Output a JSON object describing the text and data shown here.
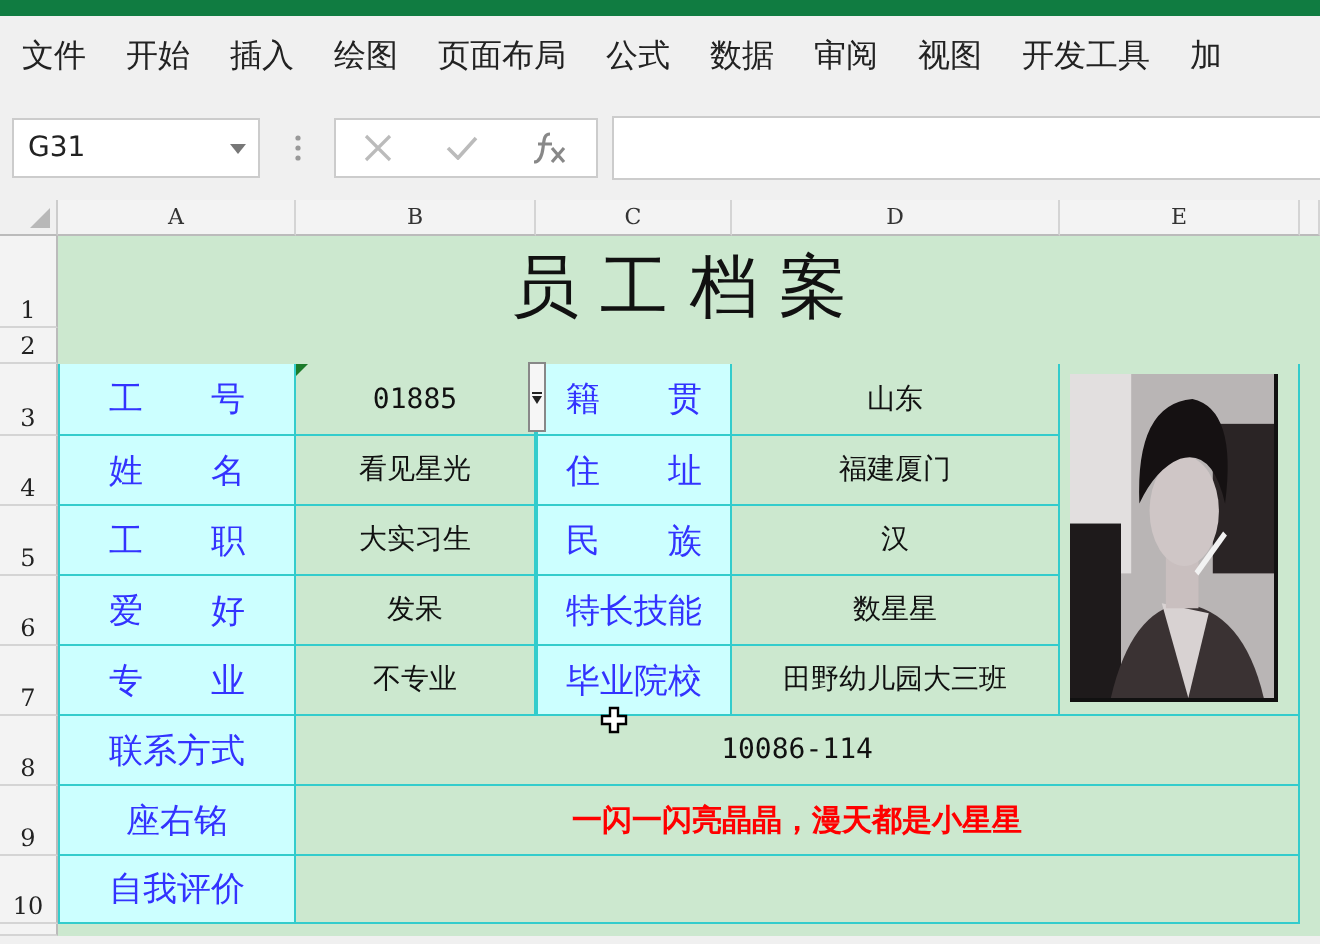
{
  "menu": [
    "文件",
    "开始",
    "插入",
    "绘图",
    "页面布局",
    "公式",
    "数据",
    "审阅",
    "视图",
    "开发工具",
    "加"
  ],
  "name_box": {
    "value": "G31"
  },
  "columns": [
    "A",
    "B",
    "C",
    "D",
    "E"
  ],
  "rows": [
    "1",
    "2",
    "3",
    "4",
    "5",
    "6",
    "7",
    "8",
    "9",
    "10"
  ],
  "sheet": {
    "title": "员 工 档 案",
    "profile": [
      {
        "label": "工　　号",
        "value": "01885",
        "label2": "籍　　贯",
        "value2": "山东",
        "dropdown": true
      },
      {
        "label": "姓　　名",
        "value": "看见星光",
        "label2": "住　　址",
        "value2": "福建厦门",
        "dropdown": false
      },
      {
        "label": "工　　职",
        "value": "大实习生",
        "label2": "民　　族",
        "value2": "汉",
        "dropdown": false
      },
      {
        "label": "爱　　好",
        "value": "发呆",
        "label2": "特长技能",
        "value2": "数星星",
        "dropdown": false
      },
      {
        "label": "专　　业",
        "value": "不专业",
        "label2": "毕业院校",
        "value2": "田野幼儿园大三班",
        "dropdown": false
      }
    ],
    "details": [
      {
        "label": "联系方式",
        "value": "10086-114",
        "emphasis": false
      },
      {
        "label": "座右铭",
        "value": "一闪一闪亮晶晶，漫天都是小星星",
        "emphasis": true
      },
      {
        "label": "自我评价"
      }
    ]
  }
}
